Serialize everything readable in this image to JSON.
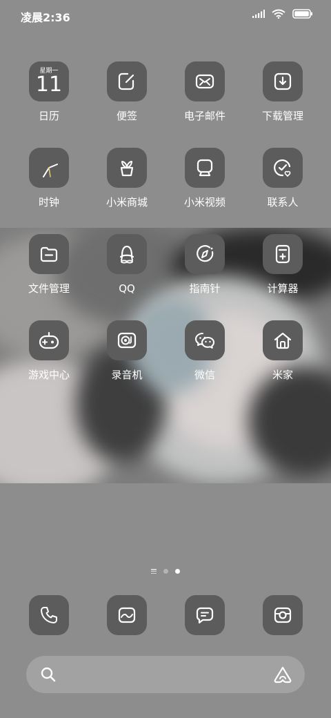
{
  "status_bar": {
    "time": "凌晨2:36",
    "icons": [
      "signal-icon",
      "wifi-icon",
      "battery-icon"
    ]
  },
  "apps": [
    {
      "label": "日历",
      "icon": "calendar-icon",
      "calendar_weekday": "星期一",
      "calendar_day": "11"
    },
    {
      "label": "便签",
      "icon": "notes-icon"
    },
    {
      "label": "电子邮件",
      "icon": "mail-icon"
    },
    {
      "label": "下载管理",
      "icon": "download-icon"
    },
    {
      "label": "时钟",
      "icon": "clock-icon"
    },
    {
      "label": "小米商城",
      "icon": "shop-icon"
    },
    {
      "label": "小米视频",
      "icon": "video-icon"
    },
    {
      "label": "联系人",
      "icon": "contacts-icon"
    },
    {
      "label": "文件管理",
      "icon": "folder-icon"
    },
    {
      "label": "QQ",
      "icon": "qq-icon"
    },
    {
      "label": "指南针",
      "icon": "compass-icon"
    },
    {
      "label": "计算器",
      "icon": "calculator-icon"
    },
    {
      "label": "游戏中心",
      "icon": "gamepad-icon"
    },
    {
      "label": "录音机",
      "icon": "recorder-icon"
    },
    {
      "label": "微信",
      "icon": "wechat-icon"
    },
    {
      "label": "米家",
      "icon": "home-icon"
    }
  ],
  "page_indicator": {
    "pages": 2,
    "current": 2
  },
  "dock": [
    {
      "icon": "phone-icon"
    },
    {
      "icon": "gallery-icon"
    },
    {
      "icon": "messages-icon"
    },
    {
      "icon": "camera-icon"
    }
  ],
  "search_bar": {
    "icon": "search-icon",
    "assistant_icon": "assistant-icon"
  },
  "colors": {
    "tile": "#5c5c5c",
    "background": "#8d8d8d",
    "search_bar": "#a2a2a2"
  }
}
